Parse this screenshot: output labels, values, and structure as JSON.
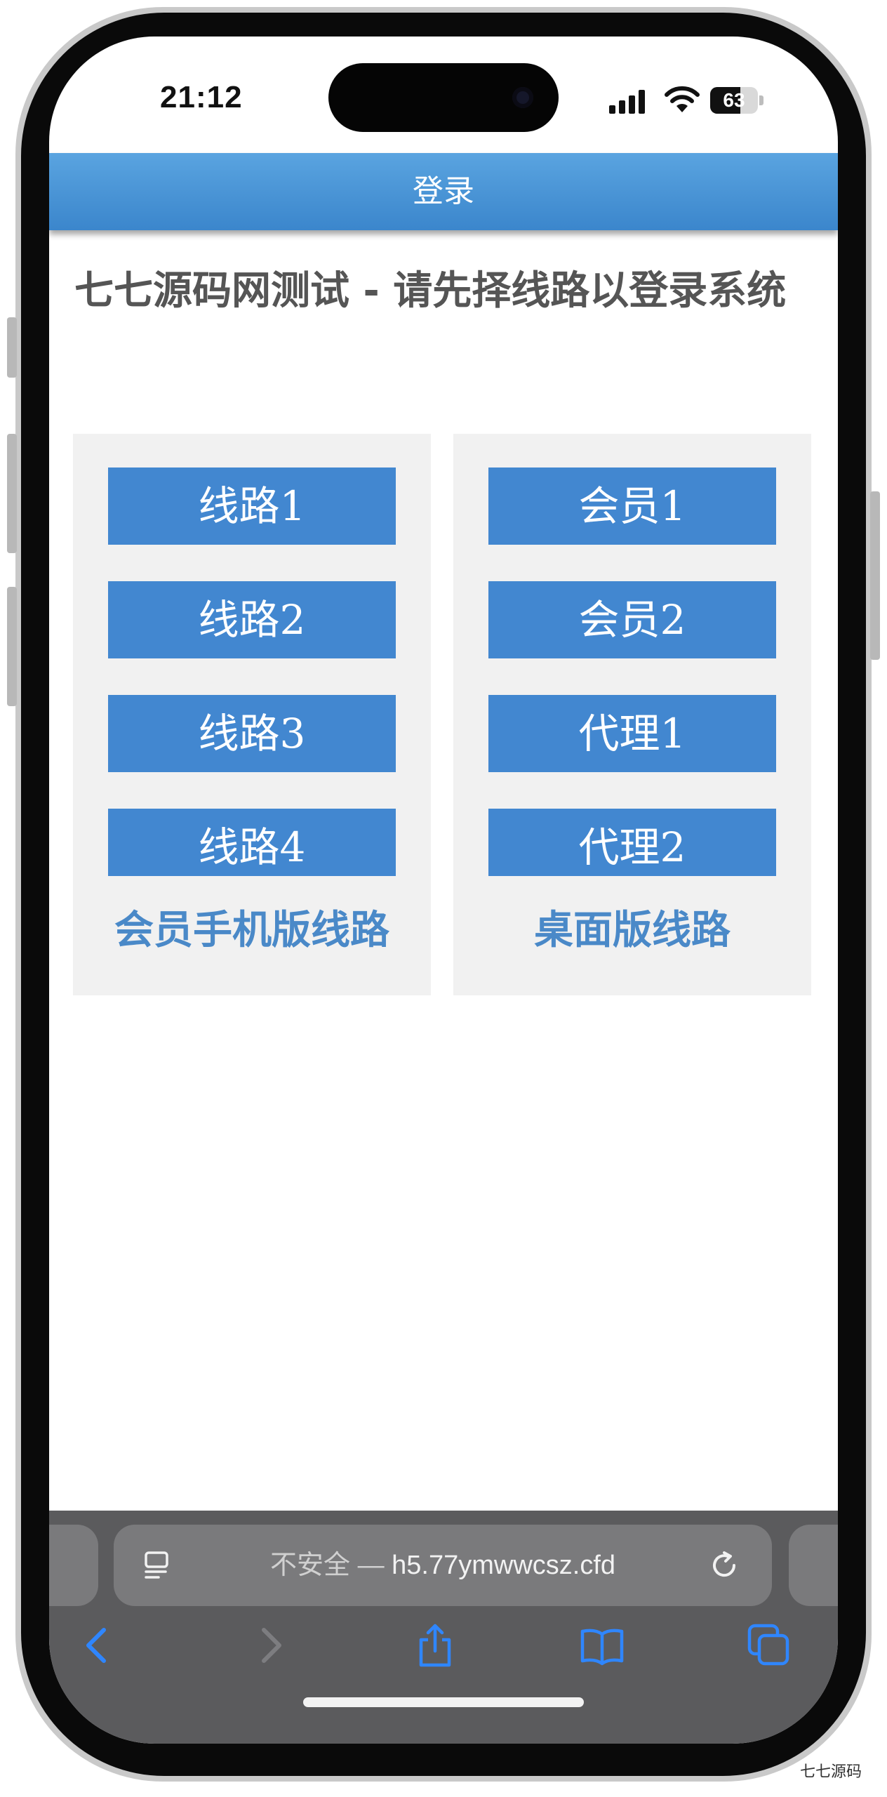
{
  "status_bar": {
    "time": "21:12",
    "battery_level": "63",
    "icons": [
      "signal-icon",
      "wifi-icon",
      "battery-icon"
    ]
  },
  "header": {
    "title": "登录"
  },
  "page": {
    "title": "七七源码网测试 - 请先择线路以登录系统"
  },
  "panels": {
    "mobile": {
      "buttons": [
        "线路1",
        "线路2",
        "线路3",
        "线路4"
      ],
      "footer": "会员手机版线路"
    },
    "desktop": {
      "buttons": [
        "会员1",
        "会员2",
        "代理1",
        "代理2"
      ],
      "footer": "桌面版线路"
    }
  },
  "browser": {
    "security_label": "不安全",
    "separator": "—",
    "url": "h5.77ymwwcsz.cfd",
    "toolbar_icons": [
      "back-icon",
      "forward-icon",
      "share-icon",
      "bookmarks-icon",
      "tabs-icon"
    ]
  },
  "watermark": "七七源码",
  "colors": {
    "header_top": "#5aa4e0",
    "header_bottom": "#3b86cc",
    "button": "#4287d0",
    "panel": "#f1f1f1",
    "footer_text": "#4a89c8",
    "title_text": "#555555",
    "toolbar": "#5b5b5d",
    "toolbar_icon": "#2f86ff"
  }
}
